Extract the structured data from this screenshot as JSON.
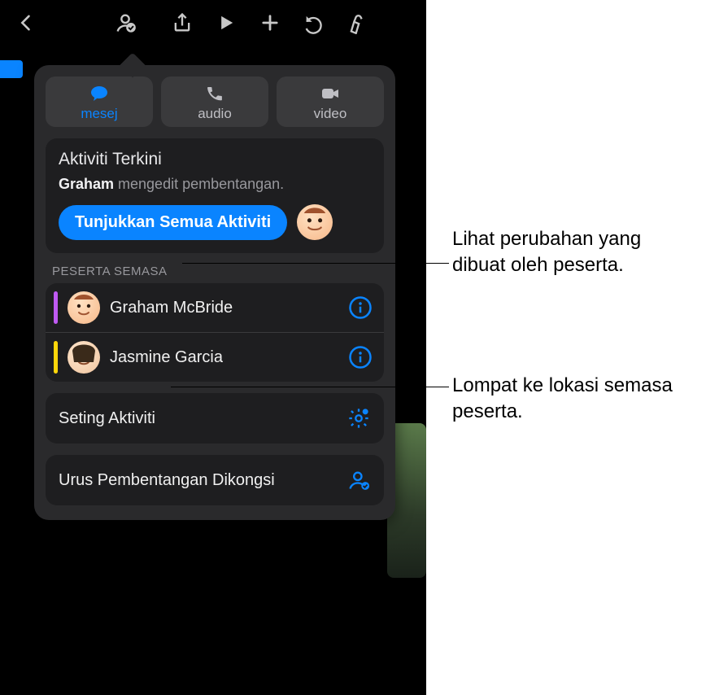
{
  "comm": {
    "message": "mesej",
    "audio": "audio",
    "video": "video"
  },
  "recent": {
    "title": "Aktiviti Terkini",
    "actor": "Graham",
    "rest": " mengedit pembentangan.",
    "show_all": "Tunjukkan Semua Aktiviti"
  },
  "participants": {
    "label": "PESERTA SEMASA",
    "items": [
      {
        "name": "Graham McBride"
      },
      {
        "name": "Jasmine Garcia"
      }
    ]
  },
  "settings_label": "Seting Aktiviti",
  "manage_label": "Urus Pembentangan Dikongsi",
  "callouts": {
    "a": "Lihat perubahan yang dibuat oleh peserta.",
    "b": "Lompat ke lokasi semasa peserta."
  }
}
